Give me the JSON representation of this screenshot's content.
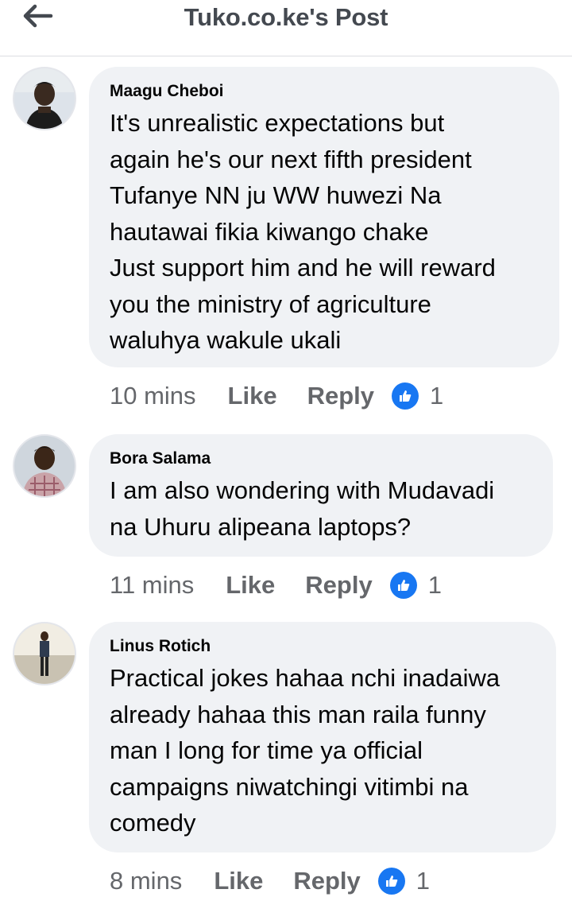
{
  "header": {
    "title": "Tuko.co.ke's Post",
    "back_icon": "arrow-left-icon"
  },
  "comments": [
    {
      "author": "Maagu Cheboi",
      "text": "It's unrealistic expectations but\nagain he's our next fifth president\nTufanye NN ju WW huwezi Na\nhautawai fikia kiwango chake\nJust support him and he will reward\nyou the ministry of agriculture\nwaluhya wakule ukali",
      "time": "10 mins",
      "like_label": "Like",
      "reply_label": "Reply",
      "reactions": "1"
    },
    {
      "author": "Bora Salama",
      "text": "I am also wondering with Mudavadi\nna Uhuru alipeana laptops?",
      "time": "11 mins",
      "like_label": "Like",
      "reply_label": "Reply",
      "reactions": "1"
    },
    {
      "author": "Linus Rotich",
      "text": "Practical jokes hahaa nchi inadaiwa\nalready hahaa this man raila funny\nman I long for time ya official\ncampaigns niwatchingi vitimbi na\ncomedy",
      "time": "8 mins",
      "like_label": "Like",
      "reply_label": "Reply",
      "reactions": "1"
    }
  ],
  "colors": {
    "bubble": "#f0f2f5",
    "like_blue": "#1877f2",
    "meta_gray": "#65676b"
  }
}
